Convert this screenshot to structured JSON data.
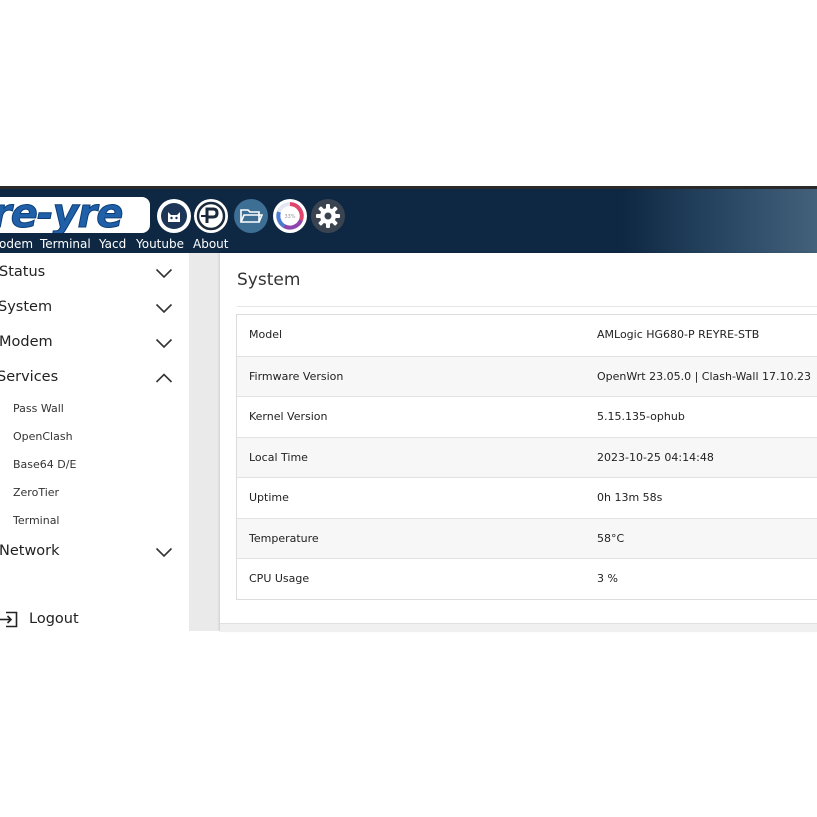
{
  "header": {
    "logo_text": "re-yre",
    "app_icons": [
      "clash-cat-icon",
      "passwall-p-icon",
      "folder-icon",
      "monitor-dial-icon",
      "gear-icon"
    ],
    "monitor_icon_text": "33%",
    "menu": [
      "odem",
      "Terminal",
      "Yacd",
      "Youtube",
      "About"
    ]
  },
  "sidebar": {
    "sections": [
      {
        "label": "Status",
        "expanded": false
      },
      {
        "label": "System",
        "expanded": false
      },
      {
        "label": "Modem",
        "expanded": false
      },
      {
        "label": "Services",
        "expanded": true,
        "items": [
          "Pass Wall",
          "OpenClash",
          "Base64 D/E",
          "ZeroTier",
          "Terminal"
        ]
      },
      {
        "label": "Network",
        "expanded": false
      }
    ],
    "logout_label": "Logout"
  },
  "main": {
    "title": "System",
    "rows": [
      {
        "key": "Model",
        "value": "AMLogic HG680-P REYRE-STB"
      },
      {
        "key": "Firmware Version",
        "value": "OpenWrt 23.05.0 | Clash-Wall 17.10.23"
      },
      {
        "key": "Kernel Version",
        "value": "5.15.135-ophub"
      },
      {
        "key": "Local Time",
        "value": "2023-10-25 04:14:48"
      },
      {
        "key": "Uptime",
        "value": "0h 13m 58s"
      },
      {
        "key": "Temperature",
        "value": "58°C"
      },
      {
        "key": "CPU Usage",
        "value": "3 %"
      }
    ]
  },
  "colors": {
    "header_bg": "#0e2742",
    "logo_blue": "#2060a8",
    "content_bg": "#ffffff",
    "gutter_bg": "#eaeaea"
  }
}
